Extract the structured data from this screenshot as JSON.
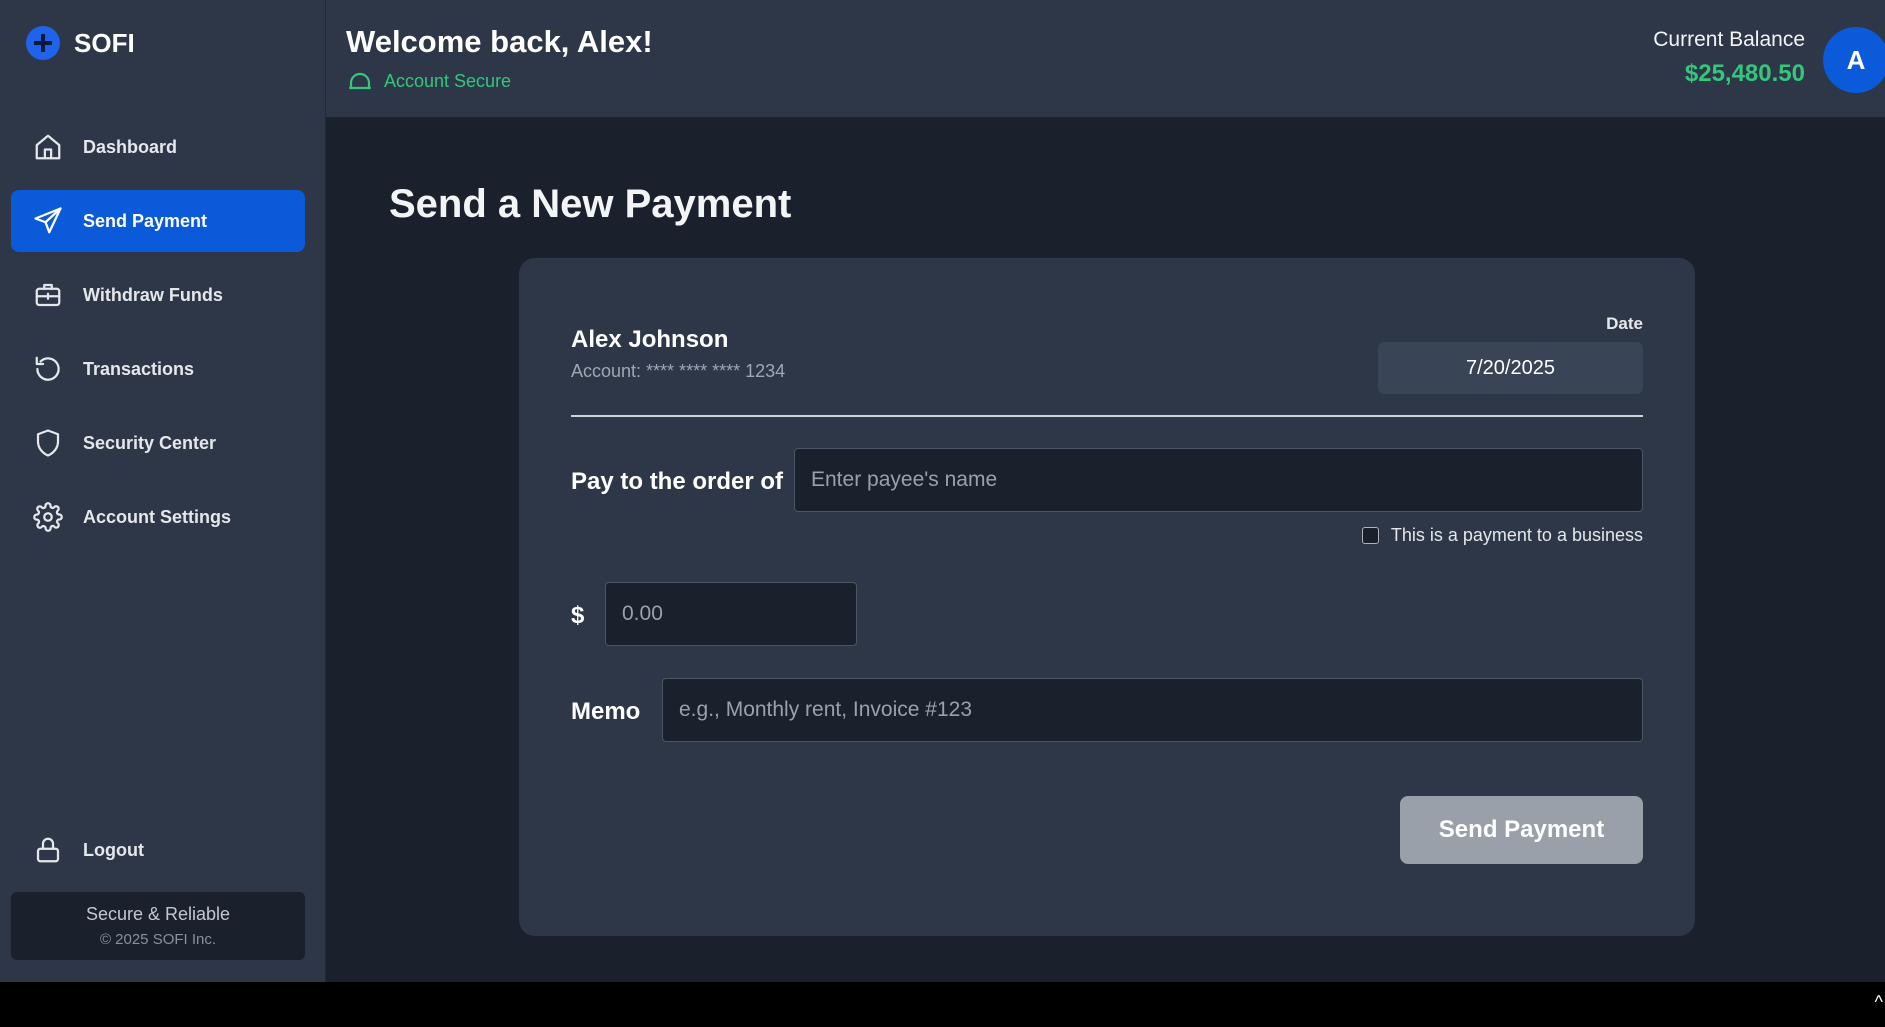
{
  "brand": {
    "name": "SOFI"
  },
  "sidebar": {
    "items": [
      {
        "label": "Dashboard",
        "icon": "home-icon"
      },
      {
        "label": "Send Payment",
        "icon": "send-icon",
        "active": true
      },
      {
        "label": "Withdraw Funds",
        "icon": "briefcase-icon"
      },
      {
        "label": "Transactions",
        "icon": "history-icon"
      },
      {
        "label": "Security Center",
        "icon": "shield-icon"
      },
      {
        "label": "Account Settings",
        "icon": "gear-icon"
      }
    ],
    "logout_label": "Logout",
    "footer_line1": "Secure & Reliable",
    "footer_line2": "© 2025 SOFI Inc."
  },
  "header": {
    "welcome": "Welcome back, Alex!",
    "status": "Account Secure",
    "balance_label": "Current Balance",
    "balance_value": "$25,480.50",
    "avatar_initial": "A"
  },
  "page": {
    "title": "Send a New Payment"
  },
  "form": {
    "payer_name": "Alex Johnson",
    "payer_account": "Account: **** **** **** 1234",
    "date_label": "Date",
    "date_value": "7/20/2025",
    "payee_label": "Pay to the order of",
    "payee_placeholder": "Enter payee's name",
    "business_label": "This is a payment to a business",
    "business_checked": false,
    "amount_symbol": "$",
    "amount_placeholder": "0.00",
    "memo_label": "Memo",
    "memo_placeholder": "e.g., Monthly rent, Invoice #123",
    "submit_label": "Send Payment"
  },
  "colors": {
    "accent": "#0b5ad9",
    "success": "#34c77b",
    "sidebar_bg": "#2d3748",
    "main_bg": "#1a202c"
  }
}
